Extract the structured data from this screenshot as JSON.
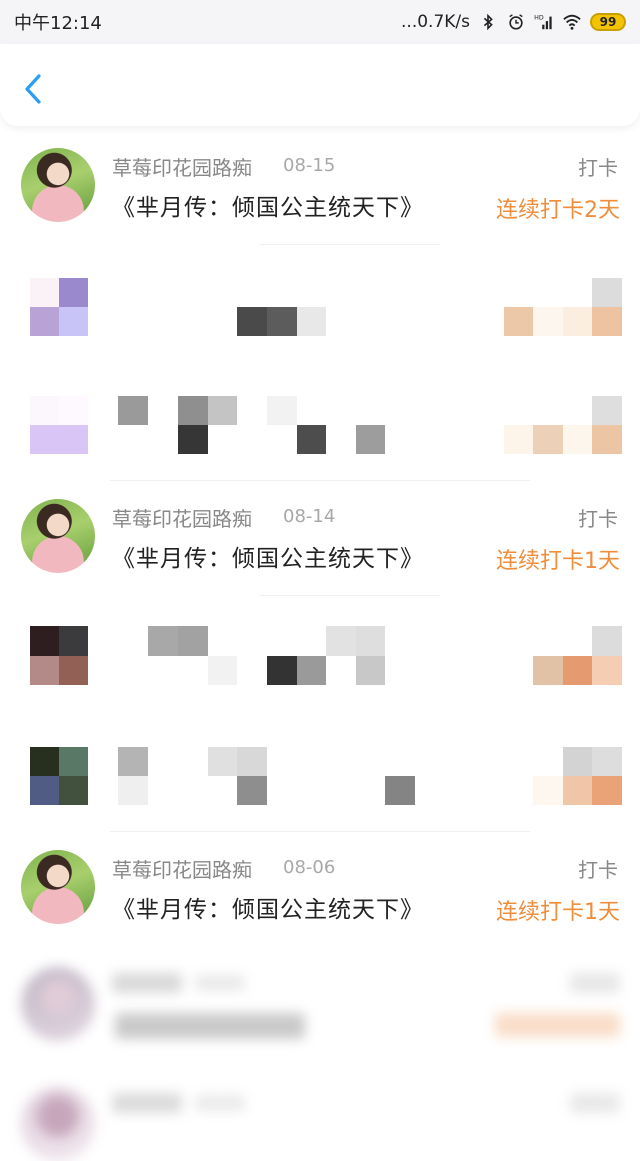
{
  "status_bar": {
    "time": "中午12:14",
    "net_speed": "...0.7K/s",
    "signal_tag": "HD",
    "battery": "99"
  },
  "nav": {
    "back_icon": "chevron-left-icon"
  },
  "accent_color": "#f08d3a",
  "entries": [
    {
      "user": "草莓印花园路痴",
      "date": "08-15",
      "tag": "打卡",
      "book": "《芈月传：倾国公主统天下》",
      "streak": "连续打卡2天"
    },
    {
      "user": "草莓印花园路痴",
      "date": "08-14",
      "tag": "打卡",
      "book": "《芈月传：倾国公主统天下》",
      "streak": "连续打卡1天"
    },
    {
      "user": "草莓印花园路痴",
      "date": "08-06",
      "tag": "打卡",
      "book": "《芈月传：倾国公主统天下》",
      "streak": "连续打卡1天"
    }
  ]
}
